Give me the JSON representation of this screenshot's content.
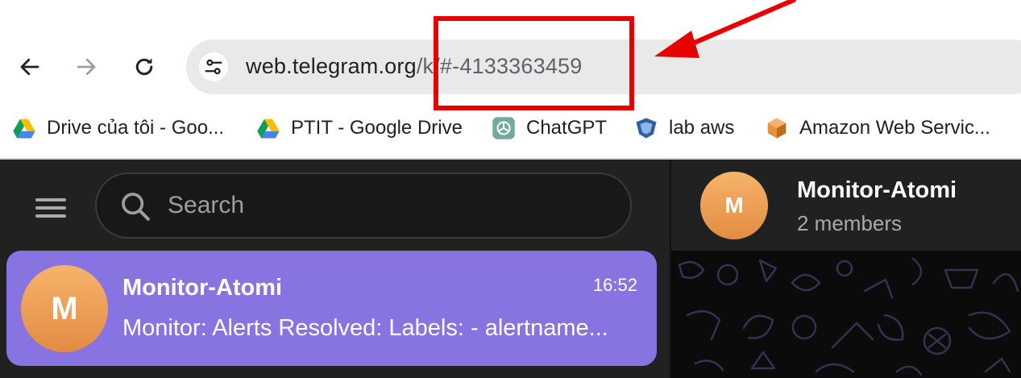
{
  "browser": {
    "address_bar": {
      "url_host": "web.telegram.org",
      "url_path": "/k/#-4133363459"
    },
    "bookmarks": [
      {
        "label": "Drive của tôi - Goo...",
        "icon": "google-drive-icon"
      },
      {
        "label": "PTIT - Google Drive",
        "icon": "google-drive-icon"
      },
      {
        "label": "ChatGPT",
        "icon": "chatgpt-icon"
      },
      {
        "label": "lab aws",
        "icon": "aws-lab-icon"
      },
      {
        "label": "Amazon Web Servic...",
        "icon": "aws-cube-icon"
      }
    ],
    "annotation_color": "#e60000"
  },
  "telegram": {
    "search": {
      "placeholder": "Search"
    },
    "chat_list": [
      {
        "avatar_letter": "M",
        "name": "Monitor-Atomi",
        "time": "16:52",
        "preview": "Monitor: Alerts Resolved: Labels: - alertname..."
      }
    ],
    "chat_header": {
      "avatar_letter": "M",
      "title": "Monitor-Atomi",
      "subtitle": "2 members"
    },
    "colors": {
      "accent": "#8774e1",
      "background": "#212121",
      "avatar": "#e99a52"
    }
  }
}
